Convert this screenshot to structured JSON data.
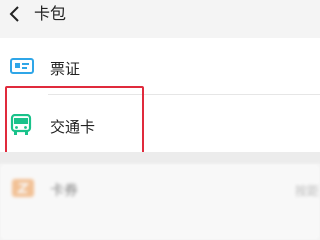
{
  "header": {
    "title": "卡包",
    "back_icon": "chevron-left-icon"
  },
  "rows": [
    {
      "label": "票证",
      "icon": "ticket-card-icon",
      "icon_color": "#2fa6e8"
    },
    {
      "label": "交通卡",
      "icon": "bus-icon",
      "icon_color": "#19c28a"
    }
  ],
  "lower": {
    "label": "卡券",
    "hint": "按距",
    "icon": "coupon-icon",
    "icon_color": "#f5a35a"
  },
  "colors": {
    "highlight": "#e02a3c",
    "background": "#efefef"
  }
}
